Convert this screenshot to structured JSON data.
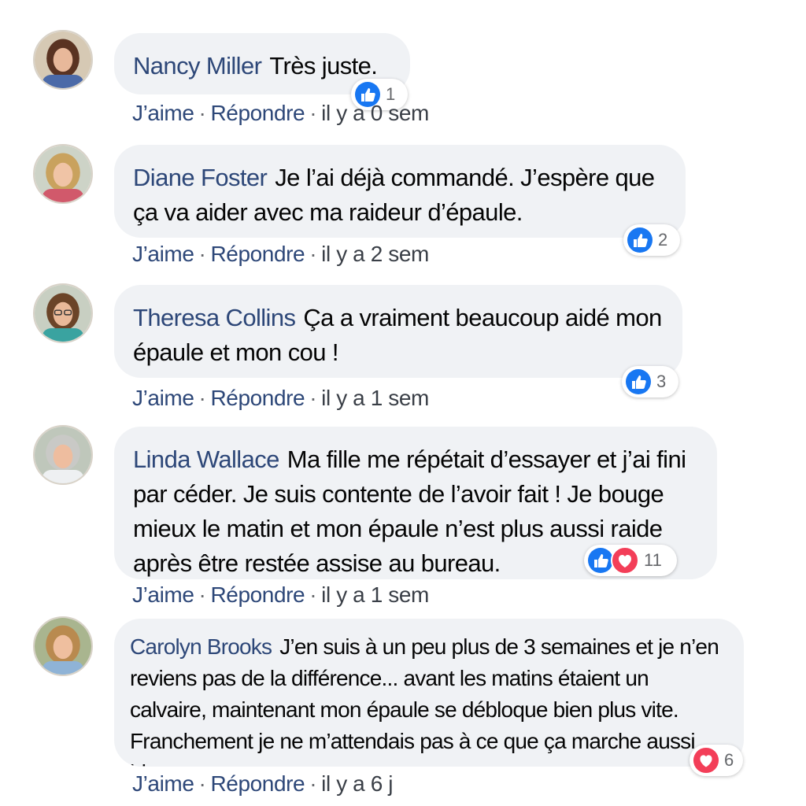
{
  "comments": [
    {
      "author": "Nancy Miller",
      "text": "Très juste.",
      "reactions": [
        "like"
      ],
      "reaction_count": "1",
      "like_label": "J’aime",
      "reply_label": "Répondre",
      "time": "il y a 0 sem"
    },
    {
      "author": "Diane Foster",
      "text": "Je l’ai déjà commandé. J’espère que ça va aider avec ma raideur d’épaule.",
      "reactions": [
        "like"
      ],
      "reaction_count": "2",
      "like_label": "J’aime",
      "reply_label": "Répondre",
      "time": "il y a 2 sem"
    },
    {
      "author": "Theresa Collins",
      "text": "Ça a vraiment beaucoup aidé mon épaule et mon cou !",
      "reactions": [
        "like"
      ],
      "reaction_count": "3",
      "like_label": "J’aime",
      "reply_label": "Répondre",
      "time": "il y a 1 sem"
    },
    {
      "author": "Linda Wallace",
      "text": "Ma fille me répétait d’essayer et j’ai fini par céder. Je suis contente de l’avoir fait ! Je bouge mieux le matin et mon épaule n’est plus aussi raide après être restée assise au bureau.",
      "reactions": [
        "like",
        "love"
      ],
      "reaction_count": "11",
      "like_label": "J’aime",
      "reply_label": "Répondre",
      "time": "il y a 1 sem"
    },
    {
      "author": "Carolyn Brooks",
      "text": "J’en suis à un peu plus de 3 semaines et je n’en reviens pas de la différence... avant les matins étaient un calvaire, maintenant mon épaule se débloque bien plus vite. Franchement je ne m’attendais pas à ce que ça marche aussi bien",
      "reactions": [
        "love"
      ],
      "reaction_count": "6",
      "like_label": "J’aime",
      "reply_label": "Répondre",
      "time": "il y a 6 j"
    }
  ],
  "colors": {
    "like_blue": "#1877f2",
    "love_red": "#f33e58",
    "name_blue": "#2d4778",
    "bubble_bg": "#f0f2f5"
  },
  "icons": {
    "like": "thumbs-up-icon",
    "love": "heart-icon"
  }
}
